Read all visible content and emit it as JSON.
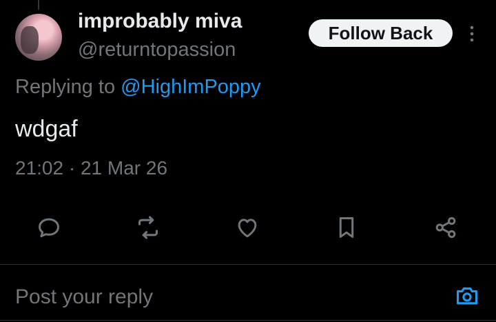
{
  "author": {
    "display_name": "improbably miva",
    "handle": "@returntopassion"
  },
  "follow_button_label": "Follow Back",
  "reply_context": {
    "prefix": "Replying to ",
    "mention": "@HighImPoppy"
  },
  "tweet": {
    "text": "wdgaf",
    "timestamp": "21:02 · 21 Mar 26"
  },
  "actions": [
    "reply-icon",
    "retweet-icon",
    "like-icon",
    "bookmark-icon",
    "share-icon"
  ],
  "reply_box": {
    "placeholder": "Post your reply",
    "camera_icon": "camera-icon"
  },
  "colors": {
    "background": "#000000",
    "text": "#e7e9ea",
    "secondary": "#71767b",
    "accent": "#1d9bf0",
    "button_bg": "#eff3f4"
  }
}
